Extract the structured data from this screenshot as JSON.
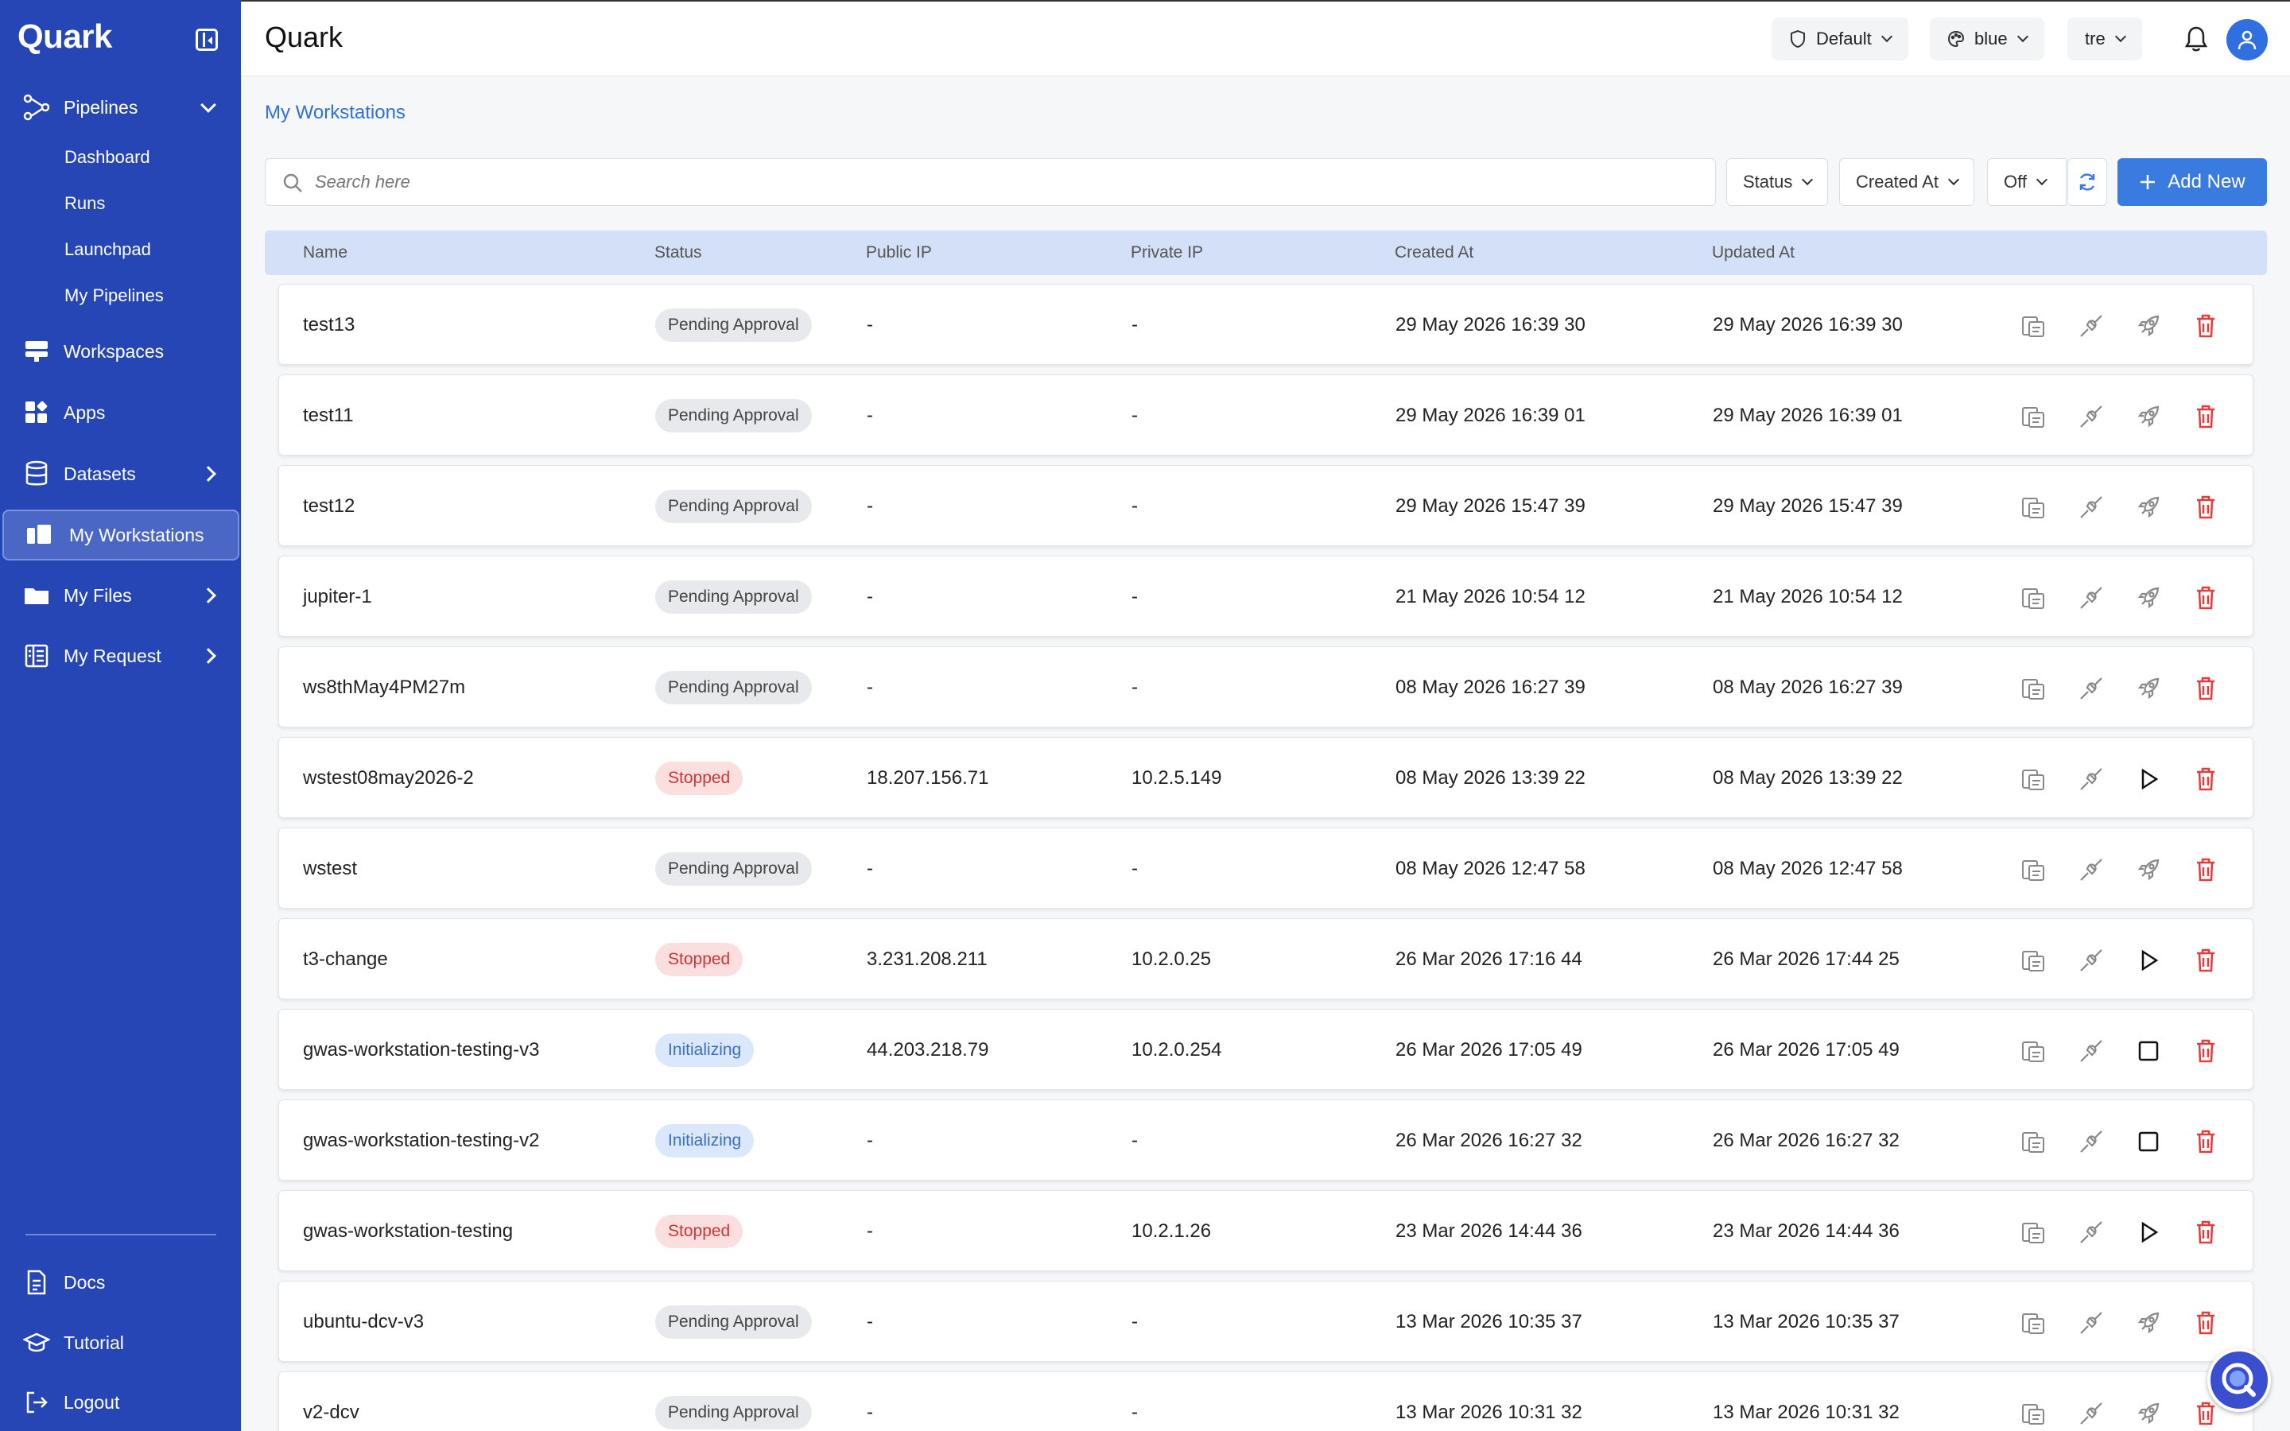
{
  "app": {
    "brand": "Quark",
    "page_title": "Quark"
  },
  "topbar": {
    "profile": "Default",
    "theme": "blue",
    "org": "tre"
  },
  "sidebar": {
    "pipelines": {
      "label": "Pipelines",
      "children": [
        "Dashboard",
        "Runs",
        "Launchpad",
        "My Pipelines"
      ]
    },
    "workspaces": "Workspaces",
    "apps": "Apps",
    "datasets": "Datasets",
    "my_workstations": "My Workstations",
    "my_files": "My Files",
    "my_request": "My Request",
    "docs": "Docs",
    "tutorial": "Tutorial",
    "logout": "Logout"
  },
  "main": {
    "breadcrumb": "My Workstations",
    "search_placeholder": "Search here",
    "filters": {
      "status": "Status",
      "created_at": "Created At",
      "auto_refresh": "Off"
    },
    "add_new": "Add New",
    "columns": [
      "Name",
      "Status",
      "Public IP",
      "Private IP",
      "Created At",
      "Updated At"
    ]
  },
  "rows": [
    {
      "name": "test13",
      "status": "Pending Approval",
      "kind": "pending",
      "public_ip": "-",
      "private_ip": "-",
      "created": "29 May 2026 16:39 30",
      "updated": "29 May 2026 16:39 30",
      "action": "launch"
    },
    {
      "name": "test11",
      "status": "Pending Approval",
      "kind": "pending",
      "public_ip": "-",
      "private_ip": "-",
      "created": "29 May 2026 16:39 01",
      "updated": "29 May 2026 16:39 01",
      "action": "launch"
    },
    {
      "name": "test12",
      "status": "Pending Approval",
      "kind": "pending",
      "public_ip": "-",
      "private_ip": "-",
      "created": "29 May 2026 15:47 39",
      "updated": "29 May 2026 15:47 39",
      "action": "launch"
    },
    {
      "name": "jupiter-1",
      "status": "Pending Approval",
      "kind": "pending",
      "public_ip": "-",
      "private_ip": "-",
      "created": "21 May 2026 10:54 12",
      "updated": "21 May 2026 10:54 12",
      "action": "launch"
    },
    {
      "name": "ws8thMay4PM27m",
      "status": "Pending Approval",
      "kind": "pending",
      "public_ip": "-",
      "private_ip": "-",
      "created": "08 May 2026 16:27 39",
      "updated": "08 May 2026 16:27 39",
      "action": "launch"
    },
    {
      "name": "wstest08may2026-2",
      "status": "Stopped",
      "kind": "stopped",
      "public_ip": "18.207.156.71",
      "private_ip": "10.2.5.149",
      "created": "08 May 2026 13:39 22",
      "updated": "08 May 2026 13:39 22",
      "action": "play"
    },
    {
      "name": "wstest",
      "status": "Pending Approval",
      "kind": "pending",
      "public_ip": "-",
      "private_ip": "-",
      "created": "08 May 2026 12:47 58",
      "updated": "08 May 2026 12:47 58",
      "action": "launch"
    },
    {
      "name": "t3-change",
      "status": "Stopped",
      "kind": "stopped",
      "public_ip": "3.231.208.211",
      "private_ip": "10.2.0.25",
      "created": "26 Mar 2026 17:16 44",
      "updated": "26 Mar 2026 17:44 25",
      "action": "play"
    },
    {
      "name": "gwas-workstation-testing-v3",
      "status": "Initializing",
      "kind": "init",
      "public_ip": "44.203.218.79",
      "private_ip": "10.2.0.254",
      "created": "26 Mar 2026 17:05 49",
      "updated": "26 Mar 2026 17:05 49",
      "action": "stop"
    },
    {
      "name": "gwas-workstation-testing-v2",
      "status": "Initializing",
      "kind": "init",
      "public_ip": "-",
      "private_ip": "-",
      "created": "26 Mar 2026 16:27 32",
      "updated": "26 Mar 2026 16:27 32",
      "action": "stop"
    },
    {
      "name": "gwas-workstation-testing",
      "status": "Stopped",
      "kind": "stopped",
      "public_ip": "-",
      "private_ip": "10.2.1.26",
      "created": "23 Mar 2026 14:44 36",
      "updated": "23 Mar 2026 14:44 36",
      "action": "play"
    },
    {
      "name": "ubuntu-dcv-v3",
      "status": "Pending Approval",
      "kind": "pending",
      "public_ip": "-",
      "private_ip": "-",
      "created": "13 Mar 2026 10:35 37",
      "updated": "13 Mar 2026 10:35 37",
      "action": "launch"
    },
    {
      "name": "v2-dcv",
      "status": "Pending Approval",
      "kind": "pending",
      "public_ip": "-",
      "private_ip": "-",
      "created": "13 Mar 2026 10:31 32",
      "updated": "13 Mar 2026 10:31 32",
      "action": "launch"
    }
  ]
}
